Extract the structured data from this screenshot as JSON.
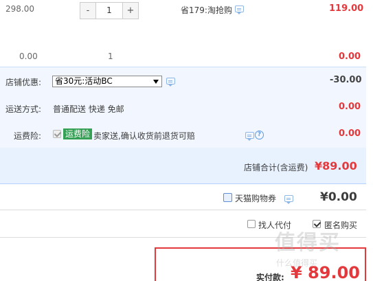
{
  "item": {
    "original_price": "298.00",
    "quantity": "1",
    "minus_label": "-",
    "plus_label": "+",
    "discount_text": "省179:淘抢购",
    "subtotal": "119.00"
  },
  "gift": {
    "price": "0.00",
    "quantity": "1",
    "subtotal": "0.00"
  },
  "shop_discount": {
    "label": "店铺优惠:",
    "selected_option": "省30元:活动BC",
    "amount": "-30.00"
  },
  "shipping": {
    "label": "运送方式:",
    "method": "普通配送 快递 免邮",
    "amount": "0.00"
  },
  "freight_insurance": {
    "label": "运费险:",
    "tag": "运费险",
    "description": "卖家送,确认收货前退货可赔",
    "help_glyph": "?",
    "amount": "0.00"
  },
  "shop_total": {
    "label": "店铺合计(含运费)",
    "amount": "¥89.00"
  },
  "tmall_coupon": {
    "label": "天猫购物券",
    "amount": "¥0.00"
  },
  "options": {
    "proxy_pay_label": "找人代付",
    "anonymous_label": "匿名购买"
  },
  "payment": {
    "label": "实付款:",
    "amount": "¥ 89.00"
  },
  "watermark": {
    "text": "值得买",
    "sub": "什么值得买"
  },
  "colors": {
    "price_red": "#e4393c",
    "section_blue": "#f2f7ff",
    "shop_total_bg": "#e8f2ff",
    "tag_green": "#37a057"
  }
}
